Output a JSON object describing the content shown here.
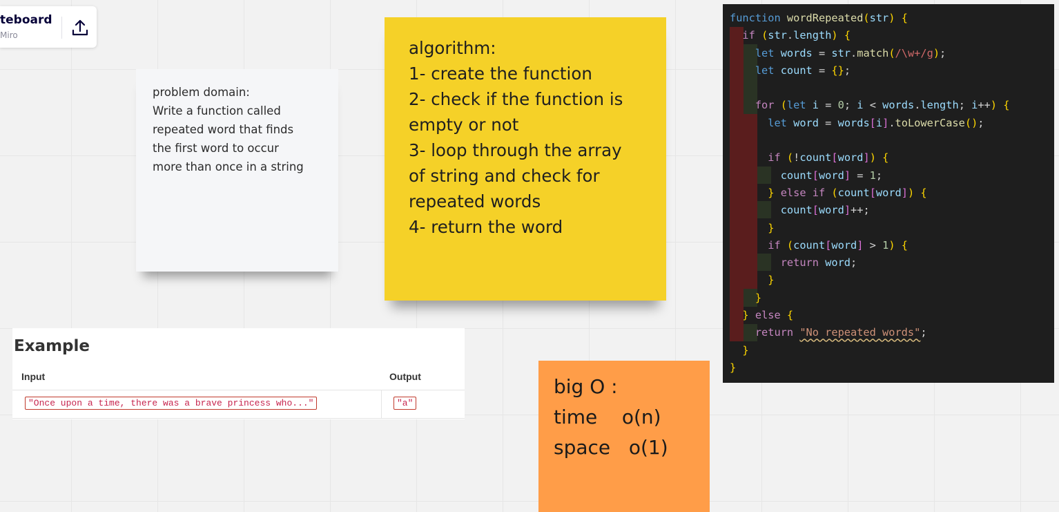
{
  "board": {
    "name": "teboard",
    "sub": "Miro",
    "share_icon": "upload-icon"
  },
  "notes": {
    "problem": "problem domain:\nWrite a function called\nrepeated word that finds\nthe first word to occur\nmore than once in a string",
    "algorithm": "algorithm:\n1- create the function\n2- check if the function is\nempty or not\n3- loop through the array\nof string and  check for\nrepeated words\n4- return the word",
    "bigo": "big O :\ntime    o(n)\nspace   o(1)"
  },
  "example": {
    "title": "Example",
    "input_header": "Input",
    "output_header": "Output",
    "input_value": "\"Once upon a time, there was a brave princess who...\"",
    "output_value": "\"a\""
  },
  "code": {
    "language": "javascript",
    "lines": [
      "function wordRepeated(str) {",
      "  if (str.length) {",
      "    let words = str.match(/\\w+/g);",
      "    let count = {};",
      "",
      "    for (let i = 0; i < words.length; i++) {",
      "      let word = words[i].toLowerCase();",
      "",
      "      if (!count[word]) {",
      "        count[word] = 1;",
      "      } else if (count[word]) {",
      "        count[word]++;",
      "      }",
      "      if (count[word] > 1) {",
      "        return word;",
      "      }",
      "    }",
      "  } else {",
      "    return \"No repeated words\";",
      "  }",
      "}"
    ]
  },
  "colors": {
    "canvas": "#f2f2f2",
    "sticky_yellow": "#f5d128",
    "sticky_orange": "#ff9d48",
    "sticky_white": "#f5f6f8",
    "editor_bg": "#1e1e1e"
  }
}
